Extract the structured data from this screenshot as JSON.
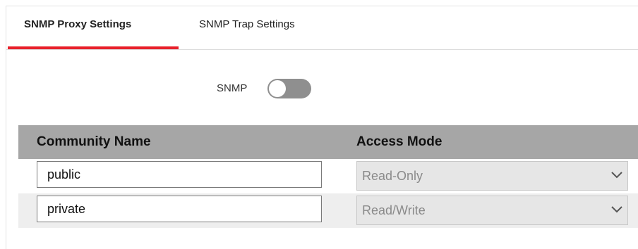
{
  "tabs": [
    {
      "label": "SNMP Proxy Settings",
      "active": true
    },
    {
      "label": "SNMP Trap Settings",
      "active": false
    }
  ],
  "snmp": {
    "label": "SNMP",
    "enabled": false
  },
  "table": {
    "headers": {
      "community": "Community Name",
      "access": "Access Mode"
    },
    "rows": [
      {
        "community": "public",
        "access": "Read-Only"
      },
      {
        "community": "private",
        "access": "Read/Write"
      }
    ]
  },
  "colors": {
    "accent": "#e8202a",
    "header_bg": "#a6a6a6",
    "toggle_off": "#8f8f8f"
  }
}
